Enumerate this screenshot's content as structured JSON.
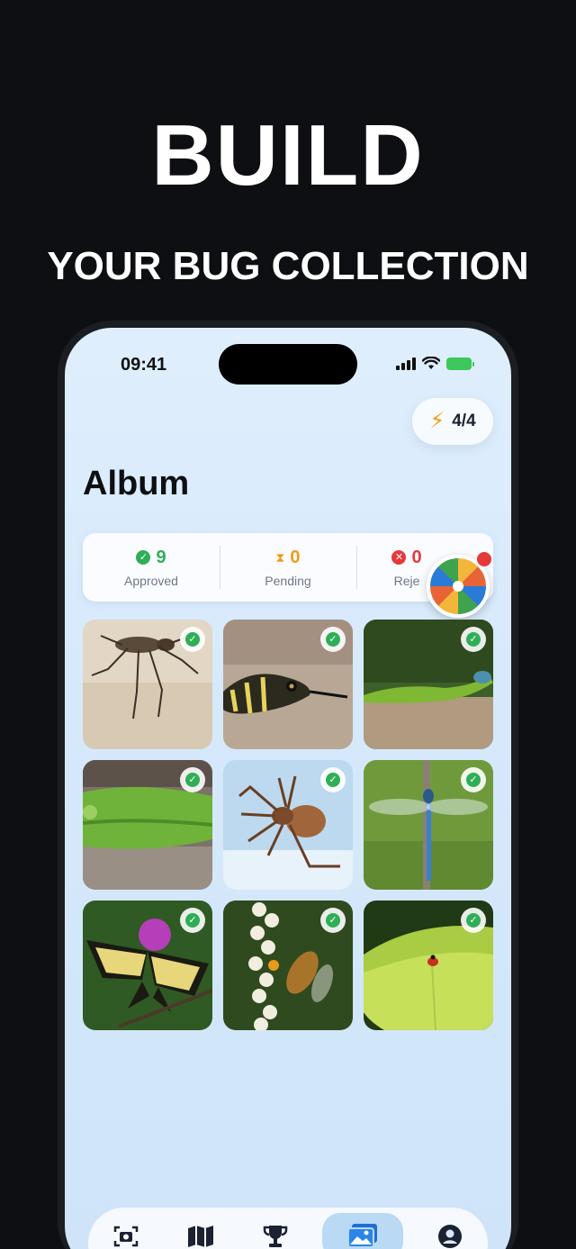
{
  "promo": {
    "headline": "BUILD",
    "subhead": "YOUR BUG COLLECTION"
  },
  "status_bar": {
    "time": "09:41"
  },
  "energy": {
    "count": "4/4",
    "icon": "bolt-icon"
  },
  "album": {
    "title": "Album"
  },
  "stats": {
    "approved": {
      "value": "9",
      "label": "Approved",
      "color": "#2fae57"
    },
    "pending": {
      "value": "0",
      "label": "Pending",
      "color": "#f29b16"
    },
    "rejected": {
      "value": "0",
      "label": "Reje",
      "color": "#e5383b"
    }
  },
  "photos": [
    {
      "subject": "tiger beetle on sand",
      "status": "approved"
    },
    {
      "subject": "grass snake head",
      "status": "approved"
    },
    {
      "subject": "green lizard on log",
      "status": "approved"
    },
    {
      "subject": "green tree frog",
      "status": "approved"
    },
    {
      "subject": "garden spider",
      "status": "approved"
    },
    {
      "subject": "blue dragonfly on stem",
      "status": "approved"
    },
    {
      "subject": "swallowtail butterfly on thistle",
      "status": "approved"
    },
    {
      "subject": "bee on white flowers",
      "status": "approved"
    },
    {
      "subject": "ladybug on leaf",
      "status": "approved"
    }
  ],
  "tabbar": {
    "items": [
      {
        "icon": "camera-scan-icon",
        "active": false
      },
      {
        "icon": "map-icon",
        "active": false
      },
      {
        "icon": "trophy-icon",
        "active": false
      },
      {
        "icon": "gallery-icon",
        "active": true
      },
      {
        "icon": "profile-icon",
        "active": false
      }
    ]
  }
}
